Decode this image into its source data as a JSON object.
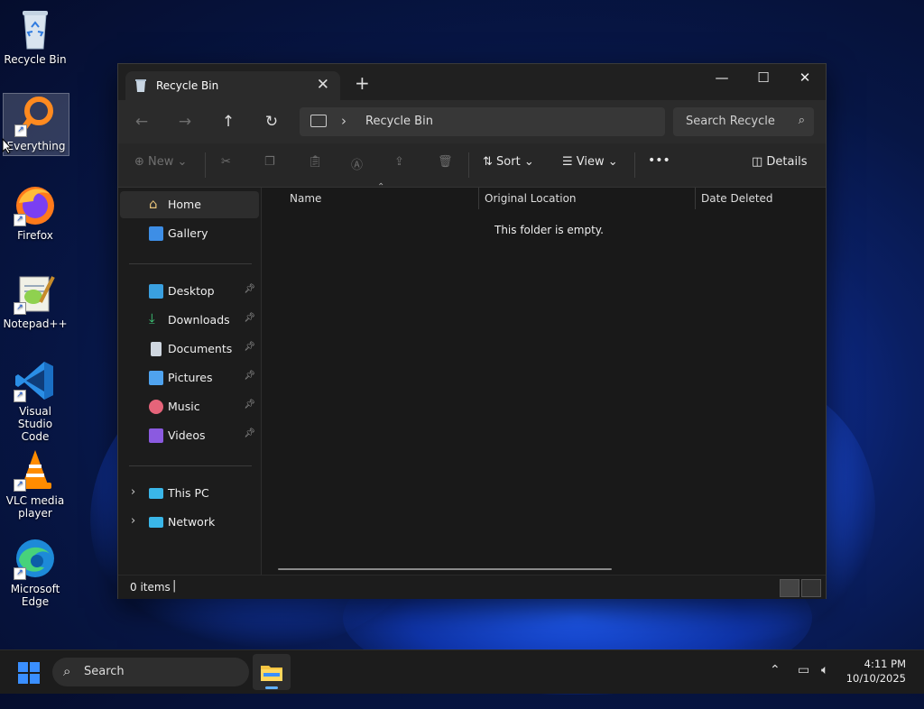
{
  "desktop": {
    "icons": [
      {
        "label": "Recycle Bin"
      },
      {
        "label": "Everything"
      },
      {
        "label": "Firefox"
      },
      {
        "label": "Notepad++"
      },
      {
        "label": "Visual Studio Code"
      },
      {
        "label": "VLC media player"
      },
      {
        "label": "Microsoft Edge"
      }
    ]
  },
  "window": {
    "tab_title": "Recycle Bin",
    "tab_close": "✕",
    "new_tab": "+",
    "controls": {
      "minimize": "—",
      "maximize": "☐",
      "close": "✕"
    },
    "nav": {
      "back": "←",
      "forward": "→",
      "up": "↑",
      "refresh": "↻"
    },
    "address": {
      "separator": "›",
      "crumb": "Recycle Bin"
    },
    "search_placeholder": "Search Recycle Bin",
    "commands": {
      "new": "New",
      "sort": "Sort",
      "view": "View",
      "more": "•••",
      "details": "Details"
    },
    "nav_pane": {
      "top": [
        {
          "label": "Home"
        },
        {
          "label": "Gallery"
        }
      ],
      "quick_access": [
        {
          "label": "Desktop"
        },
        {
          "label": "Downloads"
        },
        {
          "label": "Documents"
        },
        {
          "label": "Pictures"
        },
        {
          "label": "Music"
        },
        {
          "label": "Videos"
        }
      ],
      "bottom": [
        {
          "label": "This PC"
        },
        {
          "label": "Network"
        }
      ]
    },
    "columns": [
      "Name",
      "Original Location",
      "Date Deleted"
    ],
    "empty_message": "This folder is empty.",
    "status": {
      "items": "0 items",
      "caret": "|"
    }
  },
  "taskbar": {
    "search_label": "Search",
    "time": "4:11 PM",
    "date": "10/10/2025"
  },
  "colors": {
    "accent": "#60b0ff",
    "window_bg": "#191919",
    "taskbar_bg": "#1c1c1c"
  }
}
